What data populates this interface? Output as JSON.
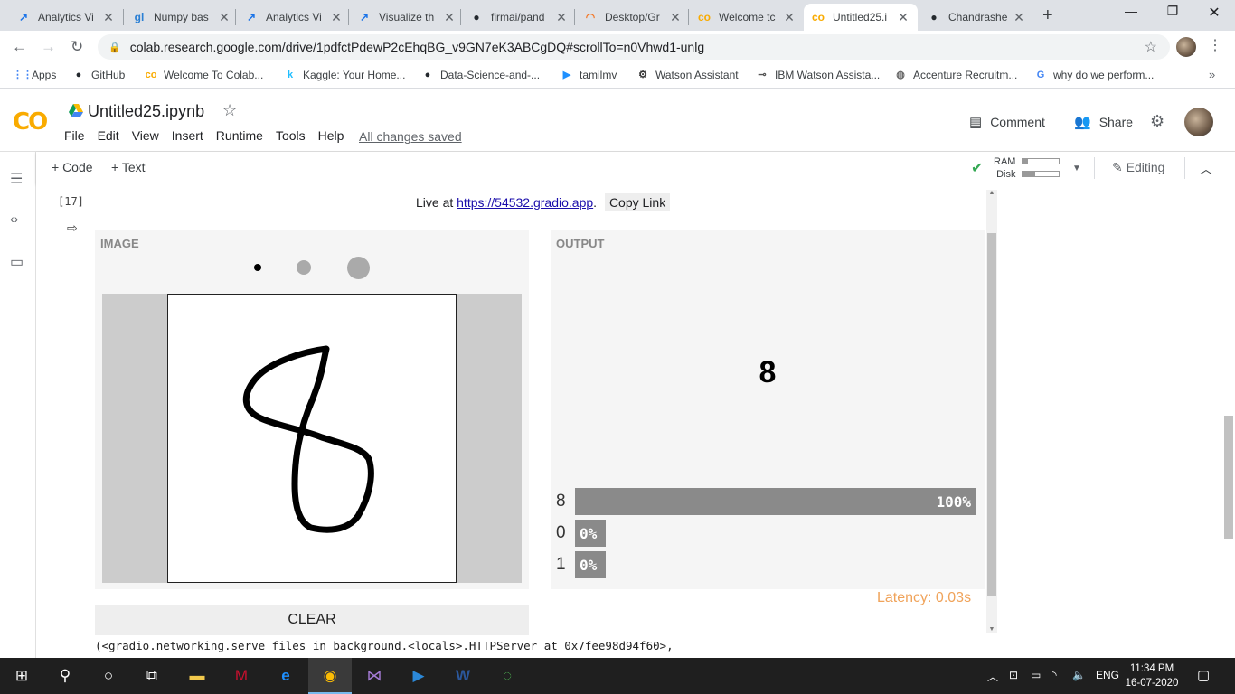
{
  "browser": {
    "tabs": [
      {
        "title": "Analytics Vi",
        "icon": "analytics-vidhya-icon",
        "icon_glyph": "↗",
        "icon_color": "#1a73e8",
        "active": false
      },
      {
        "title": "Numpy bas",
        "icon": "numpy-gl-icon",
        "icon_glyph": "gl",
        "icon_color": "#2a7fd4",
        "active": false
      },
      {
        "title": "Analytics Vi",
        "icon": "analytics-vidhya-icon",
        "icon_glyph": "↗",
        "icon_color": "#1a73e8",
        "active": false
      },
      {
        "title": "Visualize th",
        "icon": "analytics-vidhya-icon",
        "icon_glyph": "↗",
        "icon_color": "#1a73e8",
        "active": false
      },
      {
        "title": "firmai/pand",
        "icon": "github-icon",
        "icon_glyph": "●",
        "icon_color": "#24292e",
        "active": false
      },
      {
        "title": "Desktop/Gr",
        "icon": "jupyter-icon",
        "icon_glyph": "◠",
        "icon_color": "#f37626",
        "active": false
      },
      {
        "title": "Welcome tc",
        "icon": "colab-icon",
        "icon_glyph": "co",
        "icon_color": "#f9ab00",
        "active": false
      },
      {
        "title": "Untitled25.i",
        "icon": "colab-icon",
        "icon_glyph": "co",
        "icon_color": "#f9ab00",
        "active": true
      },
      {
        "title": "Chandrashe",
        "icon": "github-icon",
        "icon_glyph": "●",
        "icon_color": "#24292e",
        "active": false
      }
    ],
    "new_tab": "+",
    "url": "colab.research.google.com/drive/1pdfctPdewP2cEhqBG_v9GN7eK3ABCgDQ#scrollTo=n0Vhwd1-unlg",
    "bookmarks": [
      {
        "label": "Apps",
        "icon": "apps-grid-icon",
        "glyph": "⋮⋮",
        "color": "#4285f4"
      },
      {
        "label": "GitHub",
        "icon": "github-icon",
        "glyph": "●",
        "color": "#24292e"
      },
      {
        "label": "Welcome To Colab...",
        "icon": "colab-icon",
        "glyph": "co",
        "color": "#f9ab00"
      },
      {
        "label": "Kaggle: Your Home...",
        "icon": "kaggle-icon",
        "glyph": "k",
        "color": "#20beff"
      },
      {
        "label": "Data-Science-and-...",
        "icon": "github-icon",
        "glyph": "●",
        "color": "#24292e"
      },
      {
        "label": "tamilmv",
        "icon": "tamilmv-icon",
        "glyph": "▶",
        "color": "#1e90ff"
      },
      {
        "label": "Watson Assistant",
        "icon": "watson-icon",
        "glyph": "⚙",
        "color": "#333"
      },
      {
        "label": "IBM Watson Assista...",
        "icon": "key-icon",
        "glyph": "⊸",
        "color": "#555"
      },
      {
        "label": "Accenture Recruitm...",
        "icon": "globe-icon",
        "glyph": "◍",
        "color": "#666"
      },
      {
        "label": "why do we perform...",
        "icon": "google-icon",
        "glyph": "G",
        "color": "#4285f4"
      }
    ]
  },
  "colab": {
    "logo": "CO",
    "notebook_title": "Untitled25.ipynb",
    "menu": [
      "File",
      "Edit",
      "View",
      "Insert",
      "Runtime",
      "Tools",
      "Help"
    ],
    "save_status": "All changes saved",
    "comment_label": "Comment",
    "share_label": "Share",
    "toolbar": {
      "add_code": "+ Code",
      "add_text": "+ Text",
      "ram_label": "RAM",
      "disk_label": "Disk",
      "ram_usage": 0.15,
      "disk_usage": 0.35,
      "editing_label": "Editing"
    },
    "cell": {
      "exec_count": "[17]",
      "live_prefix": "Live at ",
      "live_url": "https://54532.gradio.app",
      "live_suffix": ".",
      "copy_link": "Copy Link"
    }
  },
  "gradio": {
    "input_label": "IMAGE",
    "output_label": "OUTPUT",
    "prediction": "8",
    "confidences": [
      {
        "label": "8",
        "percent_text": "100%",
        "value": 1.0
      },
      {
        "label": "0",
        "percent_text": "0%",
        "value": 0.0
      },
      {
        "label": "1",
        "percent_text": "0%",
        "value": 0.0
      }
    ],
    "latency": "Latency: 0.03s",
    "latency_color": "#f0a35a",
    "clear_label": "CLEAR",
    "brush_sizes": [
      "small",
      "medium",
      "large"
    ]
  },
  "stdout": "(<gradio.networking.serve_files_in_background.<locals>.HTTPServer at 0x7fee98d94f60>,",
  "taskbar": {
    "language": "ENG",
    "time": "11:34 PM",
    "date": "16-07-2020"
  }
}
